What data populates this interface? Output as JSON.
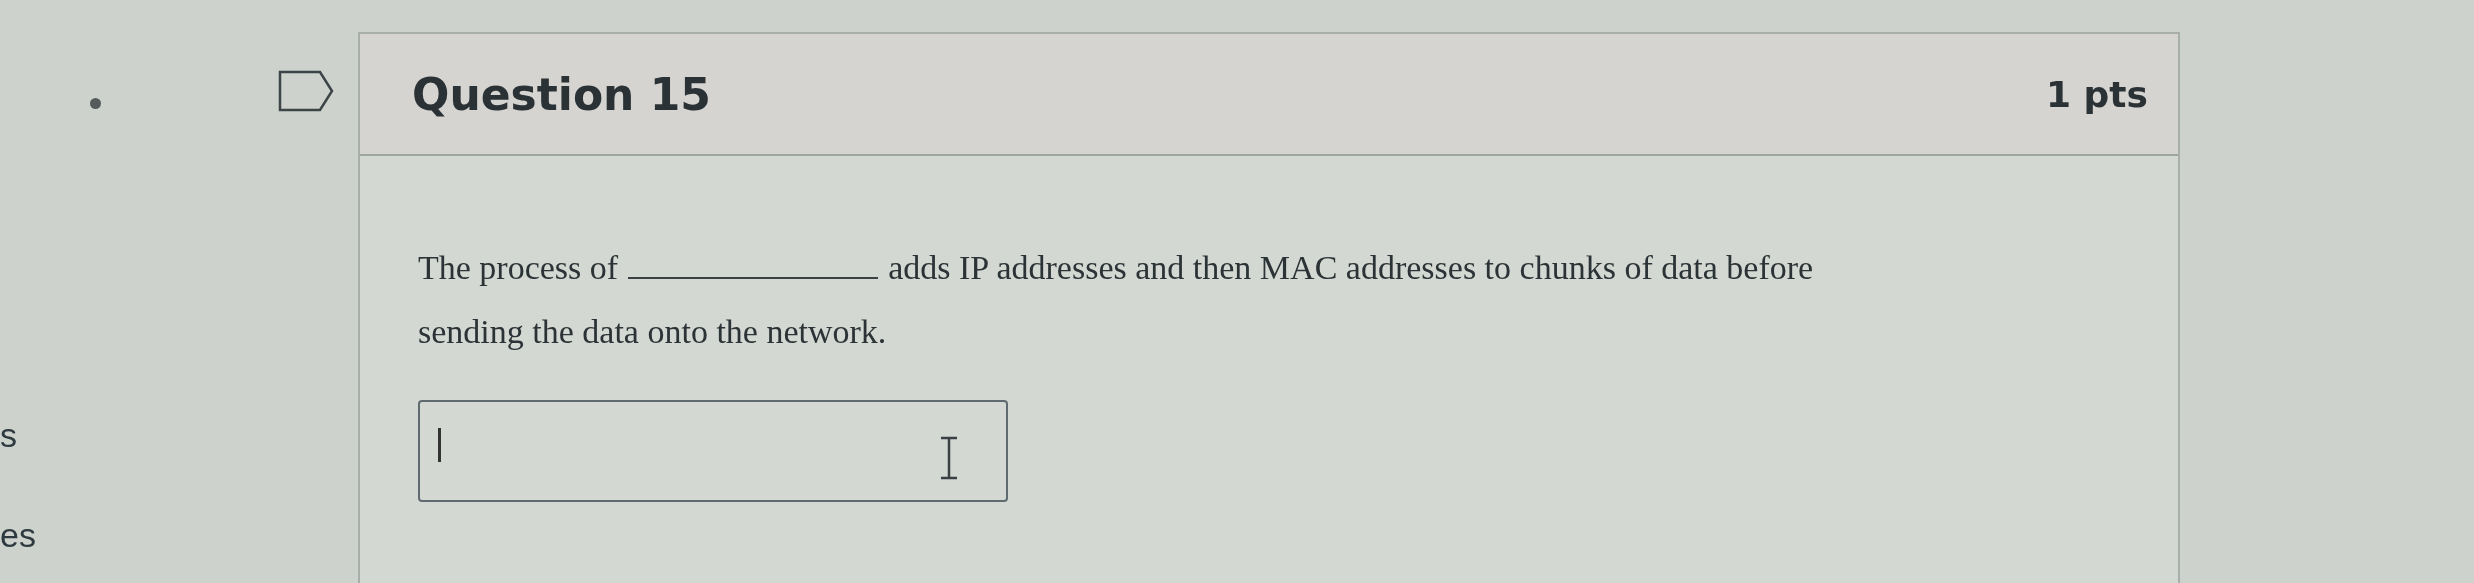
{
  "side_fragments": [
    "s",
    "es"
  ],
  "question": {
    "title": "Question 15",
    "points": "1 pts",
    "text_before": "The process of",
    "text_after": "adds IP addresses and then MAC addresses to chunks of data before",
    "text_line2": "sending the data onto the network."
  }
}
